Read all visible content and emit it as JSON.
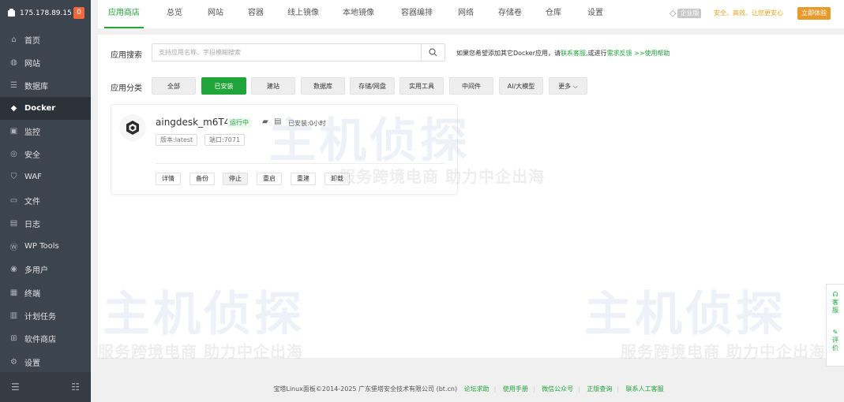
{
  "sidebar": {
    "ip": "175.178.89.15",
    "badge": "0",
    "items": [
      {
        "label": "首页",
        "icon": "home-icon"
      },
      {
        "label": "网站",
        "icon": "globe-icon"
      },
      {
        "label": "数据库",
        "icon": "database-icon"
      },
      {
        "label": "Docker",
        "icon": "docker-icon",
        "active": true
      },
      {
        "label": "监控",
        "icon": "monitor-icon"
      },
      {
        "label": "安全",
        "icon": "shield-icon"
      },
      {
        "label": "WAF",
        "icon": "waf-shield-icon"
      },
      {
        "label": "文件",
        "icon": "folder-icon"
      },
      {
        "label": "日志",
        "icon": "log-icon"
      },
      {
        "label": "WP Tools",
        "icon": "wordpress-icon"
      },
      {
        "label": "多用户",
        "icon": "users-icon"
      },
      {
        "label": "终端",
        "icon": "terminal-icon"
      },
      {
        "label": "计划任务",
        "icon": "calendar-icon"
      },
      {
        "label": "软件商店",
        "icon": "store-icon"
      },
      {
        "label": "设置",
        "icon": "gear-icon"
      }
    ]
  },
  "tabs": [
    "应用商店",
    "总览",
    "网站",
    "容器",
    "线上镜像",
    "本地镜像",
    "容器编排",
    "网络",
    "存储卷",
    "仓库",
    "设置"
  ],
  "topbar": {
    "enterprise": "企业版",
    "promo": "安全、高效、让您更安心",
    "buy": "立即体验"
  },
  "search": {
    "label": "应用搜索",
    "placeholder": "支持应用名称、字段模糊搜索",
    "hint_prefix": "如果您希望添加其它Docker应用，请",
    "hint_link1": "联系客服",
    "hint_mid": ",或进行",
    "hint_link2": "需求反馈",
    "hint_link3": ">>使用帮助"
  },
  "categories": {
    "label": "应用分类",
    "items": [
      "全部",
      "已安装",
      "建站",
      "数据库",
      "存储/网盘",
      "实用工具",
      "中间件",
      "AI/大模型",
      "更多"
    ]
  },
  "app": {
    "name": "aingdesk_m6T4",
    "status": "运行中",
    "installed": "已安装:0小时",
    "version": "版本:latest",
    "port": "端口:7071",
    "actions": [
      "详情",
      "备份",
      "停止",
      "重启",
      "重建",
      "卸载"
    ]
  },
  "watermark": {
    "big": "主机侦探",
    "small": "服务跨境电商 助力中企出海"
  },
  "footer": {
    "copyright": "宝塔Linux面板©2014-2025 广东堡塔安全技术有限公司 (bt.cn)",
    "links": [
      "论坛求助",
      "使用手册",
      "微信公众号",
      "正版查询",
      "联系人工客服"
    ]
  },
  "float": {
    "service": "客服",
    "review": "评价"
  },
  "colors": {
    "accent": "#20a53a",
    "sidebar_bg": "#3c444d",
    "badge": "#f0683b",
    "promo": "#e5a21f"
  }
}
